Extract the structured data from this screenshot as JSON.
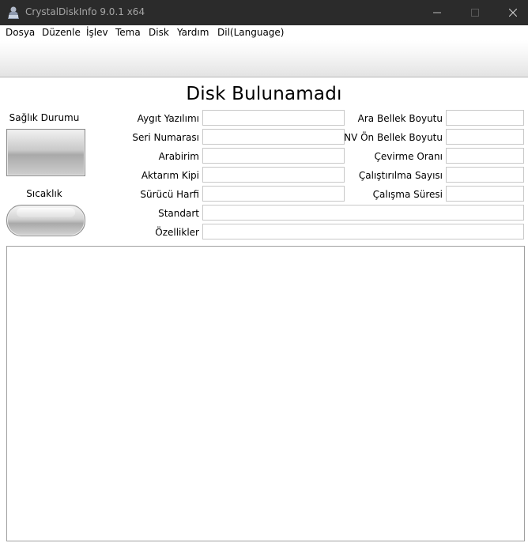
{
  "window": {
    "title": "CrystalDiskInfo 9.0.1 x64"
  },
  "menu": [
    "Dosya",
    "Düzenle",
    "İşlev",
    "Tema",
    "Disk",
    "Yardım",
    "Dil(Language)"
  ],
  "main": {
    "heading": "Disk Bulunamadı"
  },
  "left_panel": {
    "health_label": "Sağlık Durumu",
    "temperature_label": "Sıcaklık"
  },
  "fields": {
    "firmware": "Aygıt Yazılımı",
    "serial": "Seri Numarası",
    "interface": "Arabirim",
    "transfer_mode": "Aktarım Kipi",
    "drive_letter": "Sürücü Harfi",
    "standard": "Standart",
    "features": "Özellikler",
    "buffer_size": "Ara Bellek Boyutu",
    "nv_cache": "NV Ön Bellek Boyutu",
    "rotation_rate": "Çevirme Oranı",
    "power_on_count": "Çalıştırılma Sayısı",
    "power_on_hours": "Çalışma Süresi"
  }
}
